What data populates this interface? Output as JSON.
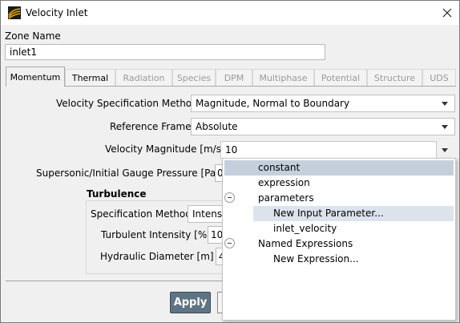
{
  "window": {
    "title": "Velocity Inlet"
  },
  "zone": {
    "label": "Zone Name",
    "value": "inlet1"
  },
  "tabs": [
    {
      "label": "Momentum"
    },
    {
      "label": "Thermal"
    },
    {
      "label": "Radiation"
    },
    {
      "label": "Species"
    },
    {
      "label": "DPM"
    },
    {
      "label": "Multiphase"
    },
    {
      "label": "Potential"
    },
    {
      "label": "Structure"
    },
    {
      "label": "UDS"
    }
  ],
  "momentum": {
    "vel_spec_label": "Velocity Specification Method",
    "vel_spec_value": "Magnitude, Normal to Boundary",
    "ref_frame_label": "Reference Frame",
    "ref_frame_value": "Absolute",
    "vel_mag_label": "Velocity Magnitude [m/s]",
    "vel_mag_value": "10",
    "pressure_label": "Supersonic/Initial Gauge Pressure [Pa]",
    "pressure_value": "0"
  },
  "turbulence": {
    "heading": "Turbulence",
    "spec_label": "Specification Method",
    "spec_value": "Intensity and Hydraulic Diameter",
    "intensity_label": "Turbulent Intensity [%]",
    "intensity_value": "10",
    "diameter_label": "Hydraulic Diameter [m]",
    "diameter_value": "4"
  },
  "buttons": {
    "apply": "Apply"
  },
  "dropdown": {
    "items": [
      "constant",
      "expression",
      "parameters",
      "New Input Parameter...",
      "inlet_velocity",
      "Named Expressions",
      "New Expression..."
    ]
  }
}
